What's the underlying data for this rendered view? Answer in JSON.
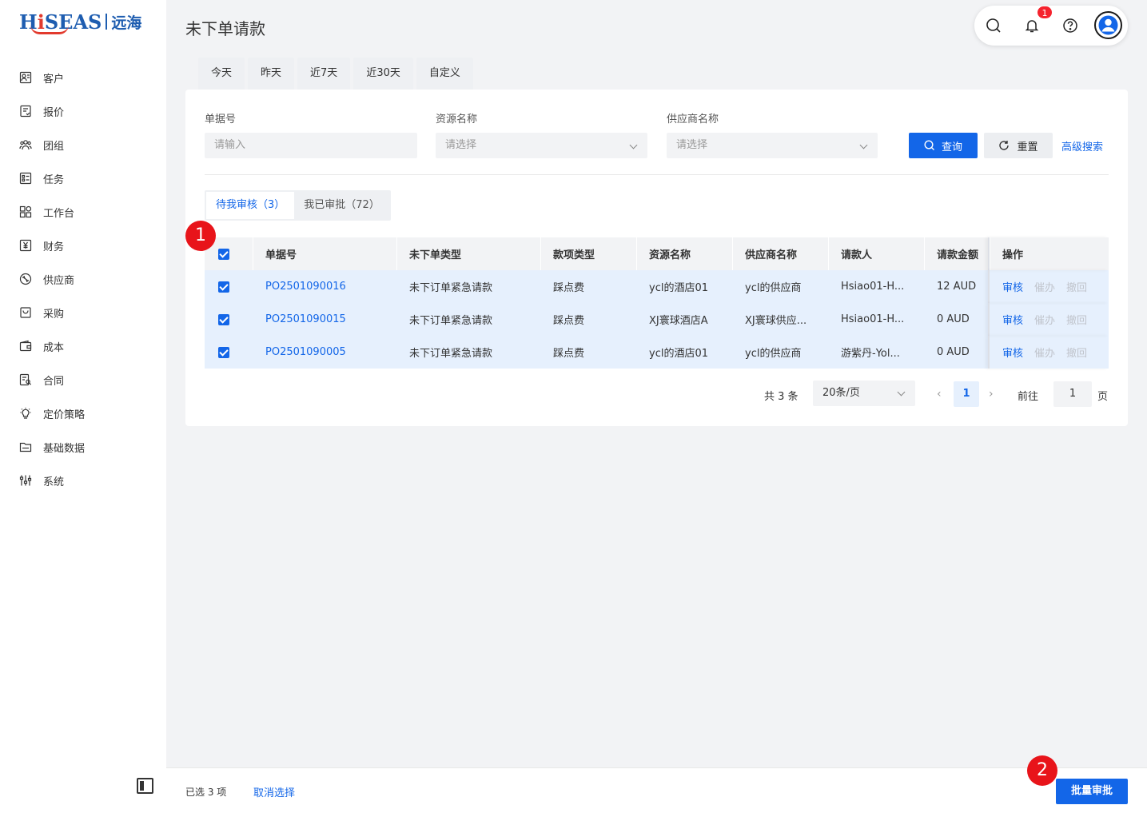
{
  "logo": {
    "brand_a": "H",
    "brand_i": "i",
    "brand_b": "SEAS",
    "cn": "远海"
  },
  "sidebar": {
    "items": [
      {
        "label": "客户",
        "icon": "customer-icon"
      },
      {
        "label": "报价",
        "icon": "quote-icon"
      },
      {
        "label": "团组",
        "icon": "group-icon"
      },
      {
        "label": "任务",
        "icon": "task-icon"
      },
      {
        "label": "工作台",
        "icon": "workbench-icon"
      },
      {
        "label": "财务",
        "icon": "finance-icon"
      },
      {
        "label": "供应商",
        "icon": "supplier-icon"
      },
      {
        "label": "采购",
        "icon": "purchase-icon"
      },
      {
        "label": "成本",
        "icon": "cost-icon"
      },
      {
        "label": "合同",
        "icon": "contract-icon"
      },
      {
        "label": "定价策略",
        "icon": "pricing-icon"
      },
      {
        "label": "基础数据",
        "icon": "basic-data-icon"
      },
      {
        "label": "系统",
        "icon": "system-icon"
      }
    ]
  },
  "header": {
    "title": "未下单请款",
    "notification_count": "1"
  },
  "date_tabs": [
    "今天",
    "昨天",
    "近7天",
    "近30天",
    "自定义"
  ],
  "filters": {
    "doc_no": {
      "label": "单据号",
      "placeholder": "请输入"
    },
    "resource": {
      "label": "资源名称",
      "placeholder": "请选择"
    },
    "supplier": {
      "label": "供应商名称",
      "placeholder": "请选择"
    },
    "query_label": "查询",
    "reset_label": "重置",
    "advanced_label": "高级搜索"
  },
  "status_tabs": [
    {
      "label": "待我审核（3）",
      "active": true
    },
    {
      "label": "我已审批（72）",
      "active": false
    }
  ],
  "table": {
    "headers": [
      "单据号",
      "未下单类型",
      "款项类型",
      "资源名称",
      "供应商名称",
      "请款人",
      "请款金额",
      "操作"
    ],
    "rows": [
      {
        "no": "PO2501090016",
        "type": "未下订单紧急请款",
        "kind": "踩点费",
        "resource": "ycl的酒店01",
        "supplier": "ycl的供应商",
        "requester": "Hsiao01-H...",
        "amount": "12 AUD"
      },
      {
        "no": "PO2501090015",
        "type": "未下订单紧急请款",
        "kind": "踩点费",
        "resource": "XJ寰球酒店A",
        "supplier": "XJ寰球供应...",
        "requester": "Hsiao01-H...",
        "amount": "0 AUD"
      },
      {
        "no": "PO2501090005",
        "type": "未下订单紧急请款",
        "kind": "踩点费",
        "resource": "ycl的酒店01",
        "supplier": "ycl的供应商",
        "requester": "游紫丹-Yol...",
        "amount": "0 AUD"
      }
    ],
    "actions": {
      "review": "审核",
      "urge": "催办",
      "revoke": "撤回"
    }
  },
  "pagination": {
    "total": "共 3 条",
    "page_size": "20条/页",
    "current": "1",
    "goto_label": "前往",
    "goto_value": "1",
    "unit": "页"
  },
  "bottom_bar": {
    "selected": "已选 3 项",
    "cancel_label": "取消选择",
    "batch_label": "批量审批"
  },
  "markers": [
    "1",
    "2"
  ],
  "colors": {
    "primary": "#1366e8",
    "selected_row": "#e6f0fd",
    "marker": "#e8141a",
    "badge": "#f5222d"
  }
}
